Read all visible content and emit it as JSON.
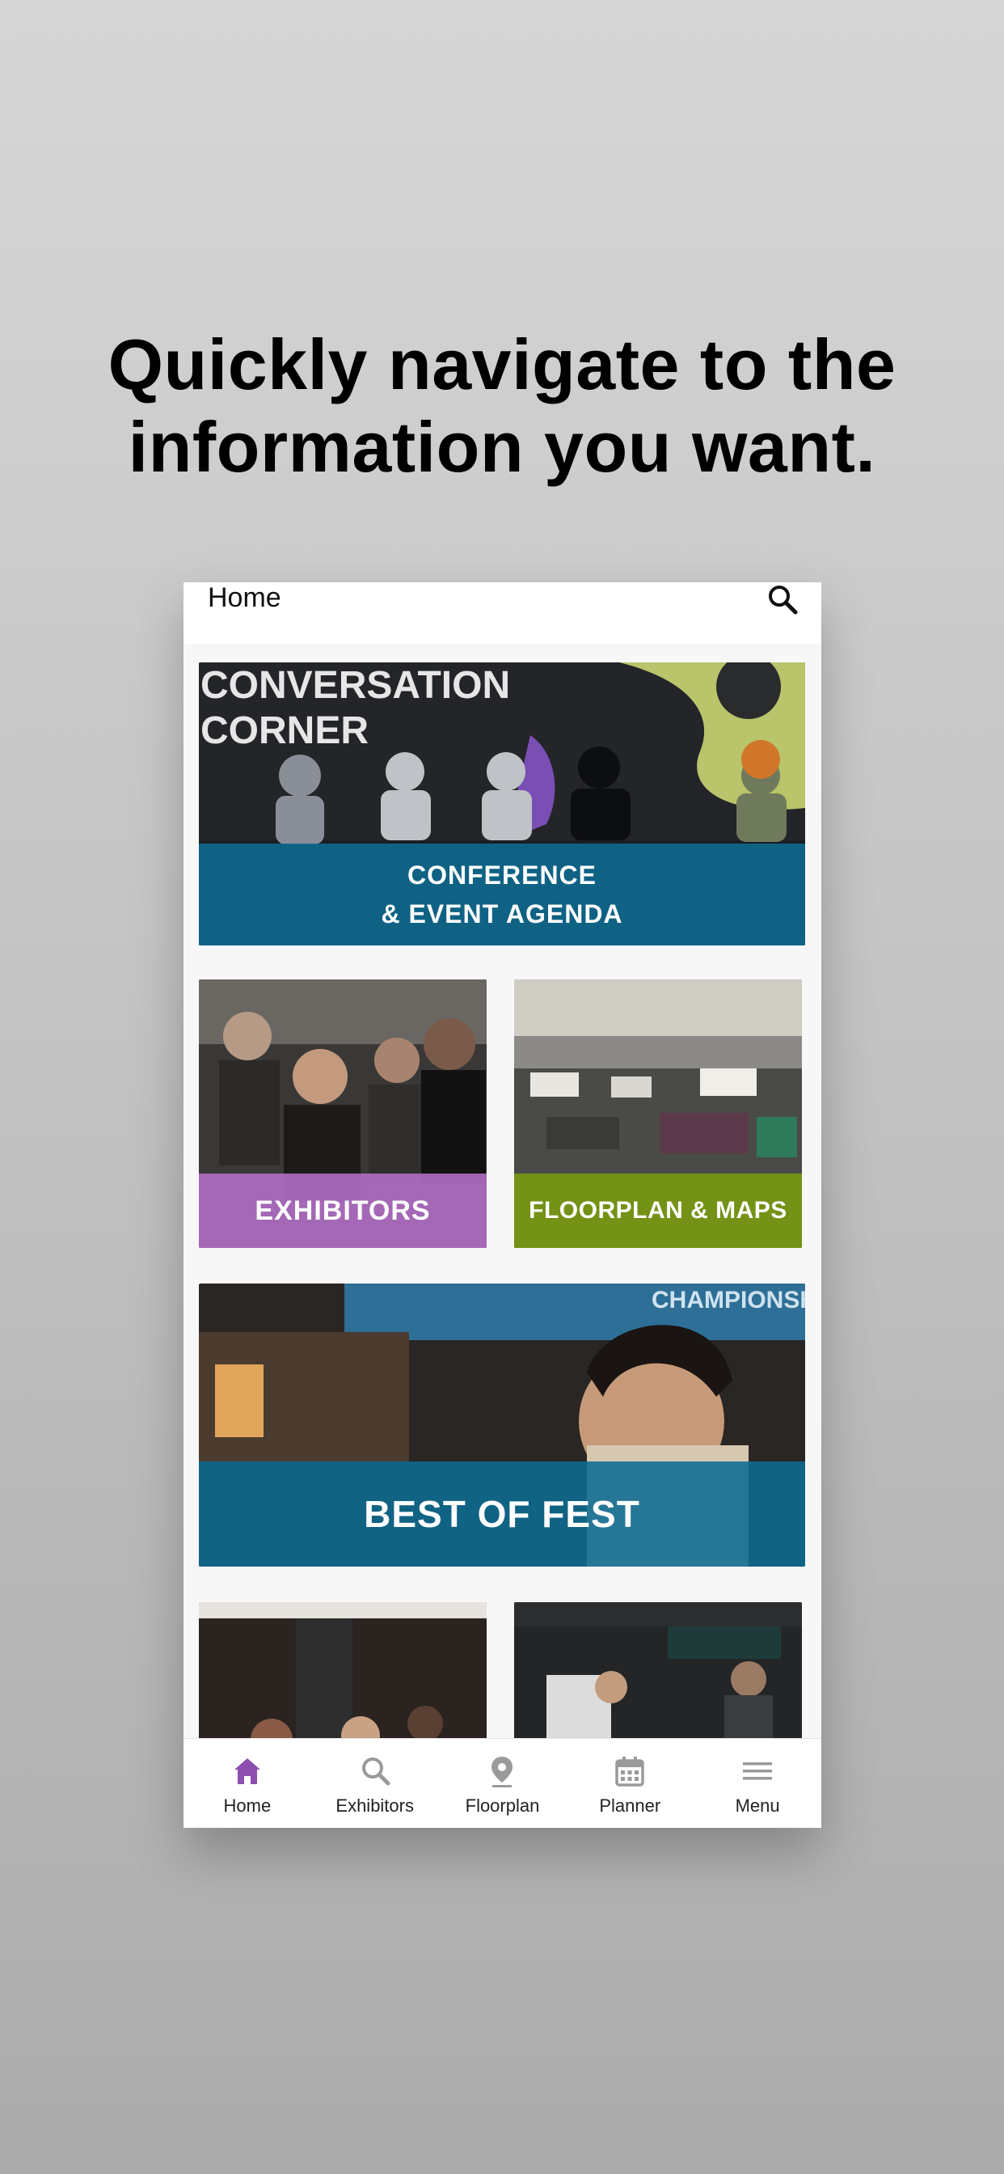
{
  "headline": {
    "line1": "Quickly navigate to the",
    "line2": "information you want."
  },
  "appbar": {
    "title": "Home",
    "search_icon": "search-icon"
  },
  "tiles": {
    "conference": {
      "line1": "CONFERENCE",
      "line2": "& EVENT AGENDA",
      "color": "#0e6c92"
    },
    "exhibitors": {
      "label": "EXHIBITORS",
      "color": "#b06ec4"
    },
    "floorplan": {
      "label": "FLOORPLAN & MAPS",
      "color": "#769812"
    },
    "best_of_fest": {
      "label": "BEST OF FEST",
      "color": "#0e6c92"
    }
  },
  "tabbar": {
    "active_color": "#8e4fae",
    "inactive_color": "#9a9a9a",
    "items": [
      {
        "label": "Home",
        "icon": "home-icon",
        "active": true
      },
      {
        "label": "Exhibitors",
        "icon": "search-icon",
        "active": false
      },
      {
        "label": "Floorplan",
        "icon": "map-pin-icon",
        "active": false
      },
      {
        "label": "Planner",
        "icon": "calendar-icon",
        "active": false
      },
      {
        "label": "Menu",
        "icon": "menu-icon",
        "active": false
      }
    ]
  }
}
